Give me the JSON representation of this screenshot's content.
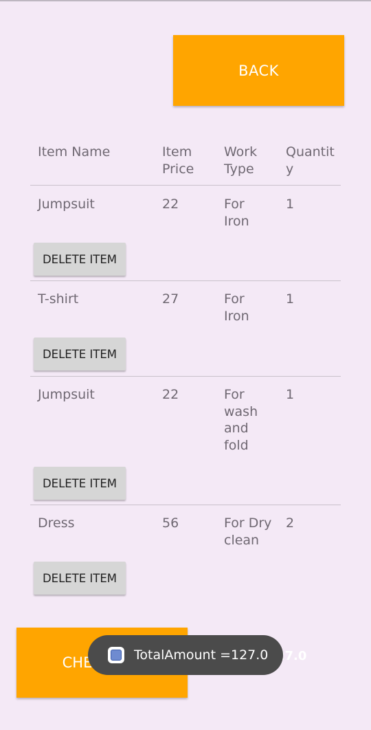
{
  "header": {
    "back_label": "BACK"
  },
  "table": {
    "columns": [
      [
        "Item Name"
      ],
      [
        "Item",
        "Price"
      ],
      [
        "Work",
        "Type"
      ],
      [
        "Quantit",
        "y"
      ]
    ],
    "rows": [
      {
        "name": "Jumpsuit",
        "price": "22",
        "work_type": [
          "For",
          "Iron"
        ],
        "quantity": "1",
        "delete_label": "DELETE ITEM"
      },
      {
        "name": "T-shirt",
        "price": "27",
        "work_type": [
          "For",
          "Iron"
        ],
        "quantity": "1",
        "delete_label": "DELETE ITEM"
      },
      {
        "name": "Jumpsuit",
        "price": "22",
        "work_type": [
          "For",
          "wash",
          "and",
          "fold"
        ],
        "quantity": "1",
        "delete_label": "DELETE ITEM"
      },
      {
        "name": "Dress",
        "price": "56",
        "work_type": [
          "For Dry",
          "clean"
        ],
        "quantity": "2",
        "delete_label": "DELETE ITEM"
      }
    ]
  },
  "footer": {
    "checkout_label": "CHECKOUT",
    "total_text_behind": "27.0"
  },
  "toast": {
    "icon": "app-icon",
    "text": "TotalAmount =127.0"
  },
  "colors": {
    "background": "#f4e9f6",
    "accent": "#ffa500",
    "delete_button": "#d6d6d6",
    "toast": "#4b4b4b"
  }
}
